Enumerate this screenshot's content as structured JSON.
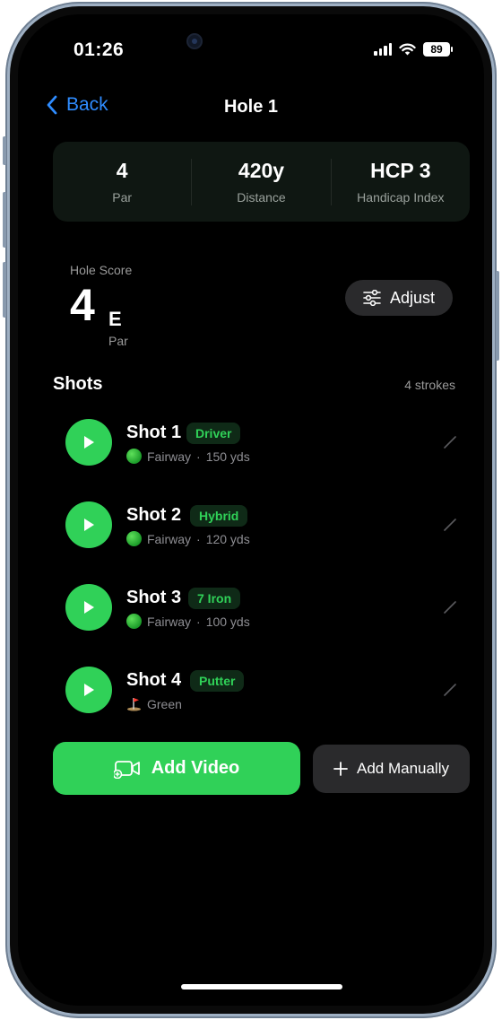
{
  "status_bar": {
    "time": "01:26",
    "battery": "89"
  },
  "nav": {
    "back_label": "Back",
    "title": "Hole 1"
  },
  "stats": [
    {
      "value": "4",
      "label": "Par"
    },
    {
      "value": "420y",
      "label": "Distance"
    },
    {
      "value": "HCP 3",
      "label": "Handicap Index"
    }
  ],
  "score": {
    "label": "Hole Score",
    "value": "4",
    "relative": "E",
    "relative_label": "Par",
    "adjust_label": "Adjust"
  },
  "shots": {
    "title": "Shots",
    "count": "4 strokes",
    "items": [
      {
        "name": "Shot 1",
        "club": "Driver",
        "lie": "Fairway",
        "sep": "·",
        "distance": "150 yds",
        "icon": "golf-ball-icon"
      },
      {
        "name": "Shot 2",
        "club": "Hybrid",
        "lie": "Fairway",
        "sep": "·",
        "distance": "120 yds",
        "icon": "golf-ball-icon"
      },
      {
        "name": "Shot 3",
        "club": "7 Iron",
        "lie": "Fairway",
        "sep": "·",
        "distance": "100 yds",
        "icon": "golf-ball-icon"
      },
      {
        "name": "Shot 4",
        "club": "Putter",
        "lie": "Green",
        "icon": "flag-in-hole-icon"
      }
    ]
  },
  "actions": {
    "add_video": "Add Video",
    "add_manually": "Add Manually"
  },
  "colors": {
    "accent": "#30d158",
    "link": "#2f8cff",
    "background": "#000000",
    "card": "#0f1712",
    "button_secondary": "#2a2a2c"
  }
}
